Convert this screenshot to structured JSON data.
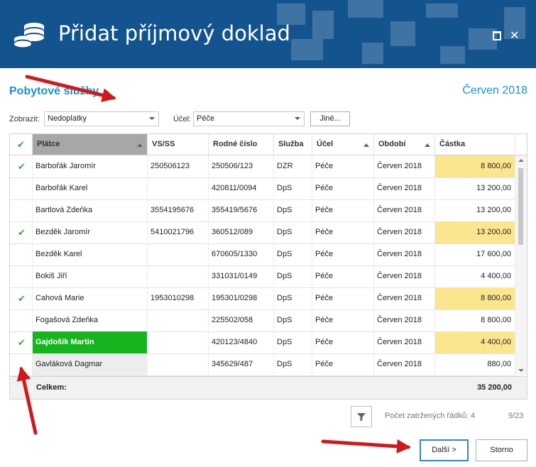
{
  "window": {
    "title": "Přidat příjmový doklad",
    "minimize_glyph": "▪",
    "close_glyph": "✕"
  },
  "section_title": "Pobytové služby",
  "period": "Červen 2018",
  "filters": {
    "show_label": "Zobrazit:",
    "show_value": "Nedoplatky",
    "purpose_label": "Účel:",
    "purpose_value": "Péče",
    "other_button": "Jiné..."
  },
  "table": {
    "columns": [
      "Plátce",
      "VS/SS",
      "Rodné číslo",
      "Služba",
      "Účel",
      "Období",
      "Částka"
    ],
    "rows": [
      {
        "checked": true,
        "name": "Barbořák Jaromír",
        "vs": "250506123",
        "rc": "250506/123",
        "service": "DZR",
        "purpose": "Péče",
        "period": "Červen 2018",
        "amount": "8 800,00",
        "highlight": true,
        "selected": false
      },
      {
        "checked": false,
        "name": "Barbořák Karel",
        "vs": "",
        "rc": "420811/0094",
        "service": "DpS",
        "purpose": "Péče",
        "period": "Červen 2018",
        "amount": "13 200,00",
        "highlight": false,
        "selected": false
      },
      {
        "checked": false,
        "name": "Bartlová Zdeňka",
        "vs": "3554195676",
        "rc": "355419/5676",
        "service": "DpS",
        "purpose": "Péče",
        "period": "Červen 2018",
        "amount": "13 200,00",
        "highlight": false,
        "selected": false
      },
      {
        "checked": true,
        "name": "Bezděk Jaromír",
        "vs": "5410021796",
        "rc": "360512/089",
        "service": "DpS",
        "purpose": "Péče",
        "period": "Červen 2018",
        "amount": "13 200,00",
        "highlight": true,
        "selected": false
      },
      {
        "checked": false,
        "name": "Bezděk Karel",
        "vs": "",
        "rc": "670605/1330",
        "service": "DpS",
        "purpose": "Péče",
        "period": "Červen 2018",
        "amount": "17 600,00",
        "highlight": false,
        "selected": false
      },
      {
        "checked": false,
        "name": "Bokiš Jiří",
        "vs": "",
        "rc": "331031/0149",
        "service": "DpS",
        "purpose": "Péče",
        "period": "Červen 2018",
        "amount": "4 400,00",
        "highlight": false,
        "selected": false
      },
      {
        "checked": true,
        "name": "Cahová Marie",
        "vs": "1953010298",
        "rc": "195301/0298",
        "service": "DpS",
        "purpose": "Péče",
        "period": "Červen 2018",
        "amount": "8 800,00",
        "highlight": true,
        "selected": false
      },
      {
        "checked": false,
        "name": "Fogašová Zdeňka",
        "vs": "",
        "rc": "225502/058",
        "service": "DpS",
        "purpose": "Péče",
        "period": "Červen 2018",
        "amount": "8 800,00",
        "highlight": false,
        "selected": false
      },
      {
        "checked": true,
        "name": "Gajdošík Martin",
        "vs": "",
        "rc": "420123/4840",
        "service": "DpS",
        "purpose": "Péče",
        "period": "Červen 2018",
        "amount": "4 400,00",
        "highlight": true,
        "selected": true
      },
      {
        "checked": false,
        "name": "Gavláková Dagmar",
        "vs": "",
        "rc": "345629/487",
        "service": "DpS",
        "purpose": "Péče",
        "period": "Červen 2018",
        "amount": "880,00",
        "highlight": false,
        "selected": false
      }
    ],
    "total_label": "Celkem:",
    "total_value": "35 200,00"
  },
  "footer": {
    "count_text": "Počet zatržených řádků: 4",
    "page_text": "9/23",
    "next_button": "Další >",
    "cancel_button": "Storno"
  },
  "colors": {
    "titlebar": "#13548f",
    "accent": "#1a8fd6",
    "check": "#39a935",
    "highlight": "#fbe68f",
    "selected_row": "#16b51f",
    "annotation_arrow": "#d0191b"
  }
}
